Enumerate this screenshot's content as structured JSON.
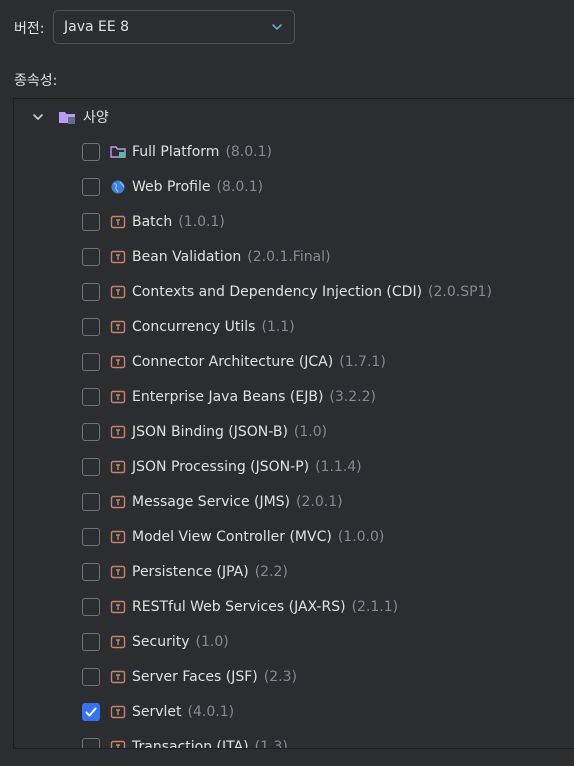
{
  "version": {
    "label": "버전:",
    "value": "Java EE 8"
  },
  "dependencies": {
    "label": "종속성:",
    "root": {
      "label": "사양",
      "expanded": true
    },
    "items": [
      {
        "name": "Full Platform",
        "version": "(8.0.1)",
        "icon": "folder-icon",
        "checked": false
      },
      {
        "name": "Web Profile",
        "version": "(8.0.1)",
        "icon": "globe-icon",
        "checked": false
      },
      {
        "name": "Batch",
        "version": "(1.0.1)",
        "icon": "library-icon",
        "checked": false
      },
      {
        "name": "Bean Validation",
        "version": "(2.0.1.Final)",
        "icon": "library-icon",
        "checked": false
      },
      {
        "name": "Contexts and Dependency Injection (CDI)",
        "version": "(2.0.SP1)",
        "icon": "library-icon",
        "checked": false
      },
      {
        "name": "Concurrency Utils",
        "version": "(1.1)",
        "icon": "library-icon",
        "checked": false
      },
      {
        "name": "Connector Architecture (JCA)",
        "version": "(1.7.1)",
        "icon": "library-icon",
        "checked": false
      },
      {
        "name": "Enterprise Java Beans (EJB)",
        "version": "(3.2.2)",
        "icon": "library-icon",
        "checked": false
      },
      {
        "name": "JSON Binding (JSON-B)",
        "version": "(1.0)",
        "icon": "library-icon",
        "checked": false
      },
      {
        "name": "JSON Processing (JSON-P)",
        "version": "(1.1.4)",
        "icon": "library-icon",
        "checked": false
      },
      {
        "name": "Message Service (JMS)",
        "version": "(2.0.1)",
        "icon": "library-icon",
        "checked": false
      },
      {
        "name": "Model View Controller (MVC)",
        "version": "(1.0.0)",
        "icon": "library-icon",
        "checked": false
      },
      {
        "name": "Persistence (JPA)",
        "version": "(2.2)",
        "icon": "library-icon",
        "checked": false
      },
      {
        "name": "RESTful Web Services (JAX-RS)",
        "version": "(2.1.1)",
        "icon": "library-icon",
        "checked": false
      },
      {
        "name": "Security",
        "version": "(1.0)",
        "icon": "library-icon",
        "checked": false
      },
      {
        "name": "Server Faces (JSF)",
        "version": "(2.3)",
        "icon": "library-icon",
        "checked": false
      },
      {
        "name": "Servlet",
        "version": "(4.0.1)",
        "icon": "library-icon",
        "checked": true
      },
      {
        "name": "Transaction (JTA)",
        "version": "(1.3)",
        "icon": "library-icon",
        "checked": false
      }
    ]
  },
  "colors": {
    "background": "#2b2d30",
    "text": "#dfe1e5",
    "muted": "#868a91",
    "accent": "#3574f0",
    "folder": "#b99bf8",
    "library": "#c7836b"
  }
}
